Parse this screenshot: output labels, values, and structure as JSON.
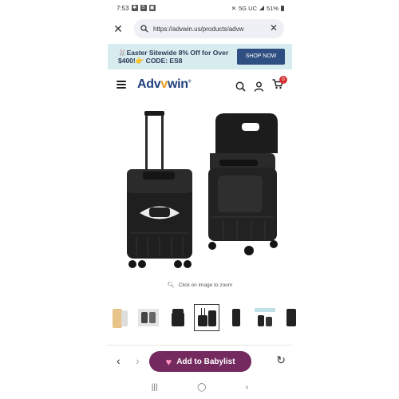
{
  "status_bar": {
    "time": "7:53",
    "carrier": "5G UC",
    "battery": "51%"
  },
  "browser": {
    "url": "https://advwin.us/products/advw"
  },
  "promo": {
    "text": "🐰Easter Sitewide 8% Off for Over $400!👉 CODE: ES8",
    "button": "SHOP NOW"
  },
  "header": {
    "logo_main": "Adv",
    "logo_accent": "v",
    "logo_rest": "win",
    "cart_count": "0"
  },
  "product": {
    "zoom_hint": "Click on image to zoom"
  },
  "bottom_bar": {
    "babylist_label": "Add to Babylist"
  },
  "colors": {
    "promo_bg": "#d6ecef",
    "promo_button": "#2f4f82",
    "logo": "#1f3f7a",
    "babylist_button": "#74295f",
    "cart_badge": "#d63030"
  }
}
